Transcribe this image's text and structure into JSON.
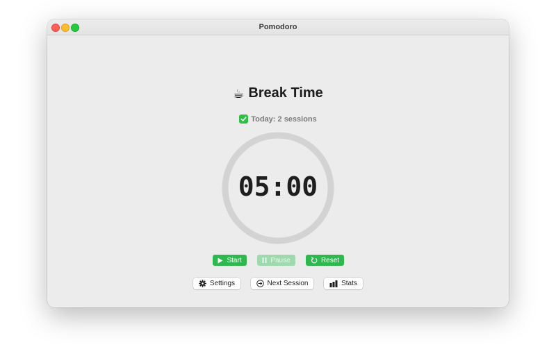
{
  "window": {
    "title": "Pomodoro"
  },
  "header": {
    "icon": "coffee-cup-icon",
    "title": "Break Time"
  },
  "status": {
    "icon": "check-mark-icon",
    "text": "Today: 2 sessions"
  },
  "timer": {
    "display": "05:00",
    "progress": 0.0,
    "ring_color": "#d3d3d3"
  },
  "controls": {
    "start_label": "Start",
    "pause_label": "Pause",
    "reset_label": "Reset",
    "accent": "#2eb84d"
  },
  "nav": {
    "settings_label": "Settings",
    "next_label": "Next Session",
    "stats_label": "Stats"
  }
}
